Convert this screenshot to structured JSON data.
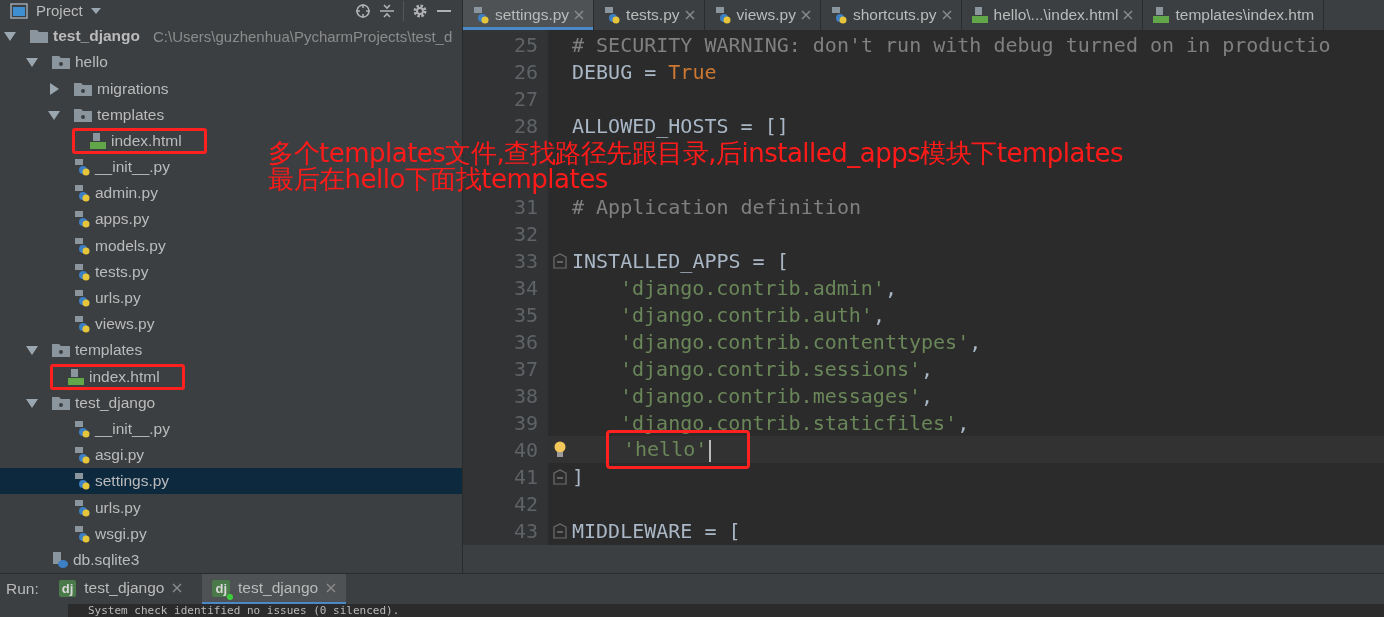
{
  "project_panel": {
    "title": "Project"
  },
  "tree": [
    {
      "name": "test_django",
      "kind": "root",
      "path": "C:\\Users\\guzhenhua\\PycharmProjects\\test_d",
      "expanded": true,
      "children": [
        {
          "name": "hello",
          "kind": "package",
          "expanded": true,
          "children": [
            {
              "name": "migrations",
              "kind": "package",
              "expanded": false
            },
            {
              "name": "templates",
              "kind": "folder",
              "expanded": true,
              "children": [
                {
                  "name": "index.html",
                  "kind": "html",
                  "marked": true,
                  "selected": false
                }
              ]
            },
            {
              "name": "__init__.py",
              "kind": "python",
              "selected": false
            },
            {
              "name": "admin.py",
              "kind": "python",
              "selected": false
            },
            {
              "name": "apps.py",
              "kind": "python",
              "selected": false
            },
            {
              "name": "models.py",
              "kind": "python",
              "selected": false
            },
            {
              "name": "tests.py",
              "kind": "python",
              "selected": false
            },
            {
              "name": "urls.py",
              "kind": "python",
              "selected": false
            },
            {
              "name": "views.py",
              "kind": "python",
              "selected": false
            }
          ]
        },
        {
          "name": "templates",
          "kind": "folder",
          "expanded": true,
          "children": [
            {
              "name": "index.html",
              "kind": "html",
              "marked": true,
              "selected": false
            }
          ]
        },
        {
          "name": "test_django",
          "kind": "package",
          "expanded": true,
          "children": [
            {
              "name": "__init__.py",
              "kind": "python",
              "selected": false
            },
            {
              "name": "asgi.py",
              "kind": "python",
              "selected": false
            },
            {
              "name": "settings.py",
              "kind": "python",
              "selected": true
            },
            {
              "name": "urls.py",
              "kind": "python",
              "selected": false
            },
            {
              "name": "wsgi.py",
              "kind": "python",
              "selected": false
            }
          ]
        },
        {
          "name": "db.sqlite3",
          "kind": "db",
          "selected": false
        }
      ]
    }
  ],
  "editor_tabs": [
    {
      "label": "settings.py",
      "kind": "python",
      "selected": true
    },
    {
      "label": "tests.py",
      "kind": "python",
      "selected": false
    },
    {
      "label": "views.py",
      "kind": "python",
      "selected": false
    },
    {
      "label": "shortcuts.py",
      "kind": "python",
      "selected": false
    },
    {
      "label": "hello\\...\\index.html",
      "kind": "html",
      "selected": false
    },
    {
      "label": "templates\\index.htm",
      "kind": "html",
      "selected": false
    }
  ],
  "code_lines": [
    {
      "number": "25",
      "segments": [
        {
          "kind": "comment",
          "text": "# SECURITY WARNING: don't run with debug turned on in productio"
        }
      ]
    },
    {
      "number": "26",
      "segments": [
        {
          "kind": "plain",
          "text": "DEBUG = "
        },
        {
          "kind": "keyword",
          "text": "True"
        }
      ]
    },
    {
      "number": "27"
    },
    {
      "number": "28",
      "segments": [
        {
          "kind": "plain",
          "text": "ALLOWED_HOSTS = []"
        }
      ]
    },
    {
      "kind": "covered"
    },
    {
      "kind": "covered"
    },
    {
      "number": "31",
      "segments": [
        {
          "kind": "comment",
          "text": "# Application definition"
        }
      ]
    },
    {
      "number": "32"
    },
    {
      "number": "33",
      "fold": true,
      "segments": [
        {
          "kind": "plain",
          "text": "INSTALLED_APPS = ["
        }
      ]
    },
    {
      "number": "34",
      "indented": true,
      "segments": [
        {
          "kind": "string",
          "text": "'django.contrib.admin'"
        },
        {
          "kind": "plain",
          "text": ","
        }
      ]
    },
    {
      "number": "35",
      "indented": true,
      "segments": [
        {
          "kind": "string",
          "text": "'django.contrib.auth'"
        },
        {
          "kind": "plain",
          "text": ","
        }
      ]
    },
    {
      "number": "36",
      "indented": true,
      "segments": [
        {
          "kind": "string",
          "text": "'django.contrib.contenttypes'"
        },
        {
          "kind": "plain",
          "text": ","
        }
      ]
    },
    {
      "number": "37",
      "indented": true,
      "segments": [
        {
          "kind": "string",
          "text": "'django.contrib.sessions'"
        },
        {
          "kind": "plain",
          "text": ","
        }
      ]
    },
    {
      "number": "38",
      "indented": true,
      "segments": [
        {
          "kind": "string",
          "text": "'django.contrib.messages'"
        },
        {
          "kind": "plain",
          "text": ","
        }
      ]
    },
    {
      "number": "39",
      "indented": true,
      "segments": [
        {
          "kind": "string",
          "text": "'django.contrib.staticfiles'"
        },
        {
          "kind": "plain",
          "text": ","
        }
      ]
    },
    {
      "number": "40",
      "indented": true,
      "current": true,
      "bulb": true,
      "marked": true,
      "segments": [
        {
          "kind": "string",
          "text": "'hello'"
        }
      ]
    },
    {
      "number": "41",
      "fold": true,
      "segments": [
        {
          "kind": "plain",
          "text": "]"
        }
      ]
    },
    {
      "number": "42"
    },
    {
      "number": "43",
      "fold": true,
      "segments": [
        {
          "kind": "plain",
          "text": "MIDDLEWARE = ["
        }
      ]
    }
  ],
  "annotation": {
    "lines": [
      "多个templates文件,查找路径先跟目录,后installed_apps模块下templates",
      "最后在hello下面找templates"
    ]
  },
  "run_bar": {
    "label": "Run:",
    "tabs": [
      {
        "icon": "dj",
        "label": "test_django",
        "running": false,
        "selected": false
      },
      {
        "icon": "dj",
        "label": "test_django",
        "running": true,
        "selected": true
      }
    ]
  },
  "console": {
    "text": "System check identified no issues (0 silenced)."
  }
}
